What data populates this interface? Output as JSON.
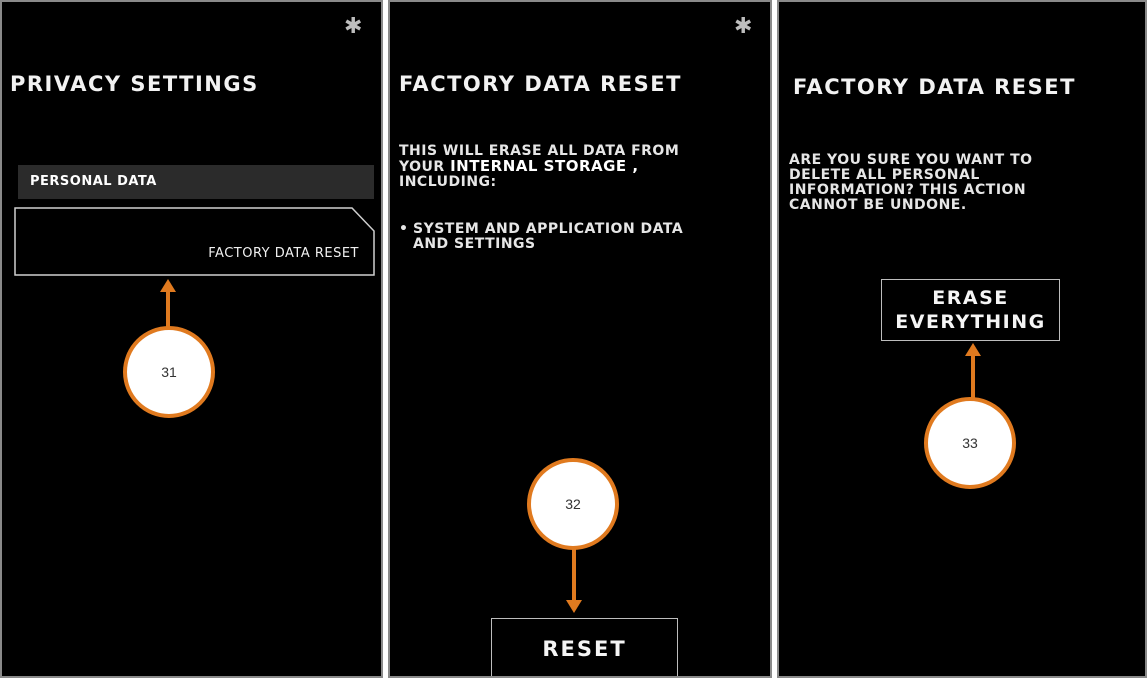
{
  "screens": [
    {
      "bluetooth_icon": "bluetooth-icon",
      "title": "PRIVACY SETTINGS",
      "section_label": "PERSONAL DATA",
      "menu_item": "FACTORY DATA RESET",
      "callout": "31"
    },
    {
      "bluetooth_icon": "bluetooth-icon",
      "title": "FACTORY DATA RESET",
      "line1": "THIS WILL ERASE ALL DATA FROM",
      "line2_prefix": "YOUR ",
      "line2_bold": "INTERNAL STORAGE ,",
      "line3": "INCLUDING:",
      "bullet": "•",
      "bullet_line1": "SYSTEM AND APPLICATION DATA",
      "bullet_line2": "AND SETTINGS",
      "button": "RESET",
      "callout": "32"
    },
    {
      "title": "FACTORY DATA RESET",
      "line1": "ARE YOU SURE YOU WANT TO",
      "line2": "DELETE ALL PERSONAL",
      "line3": "INFORMATION? THIS ACTION",
      "line4": "CANNOT BE UNDONE.",
      "button_line1": "ERASE",
      "button_line2": "EVERYTHING",
      "callout": "33"
    }
  ],
  "colors": {
    "accent": "#e07a1f",
    "background": "#000000",
    "panel_border": "#8a8a8a"
  }
}
